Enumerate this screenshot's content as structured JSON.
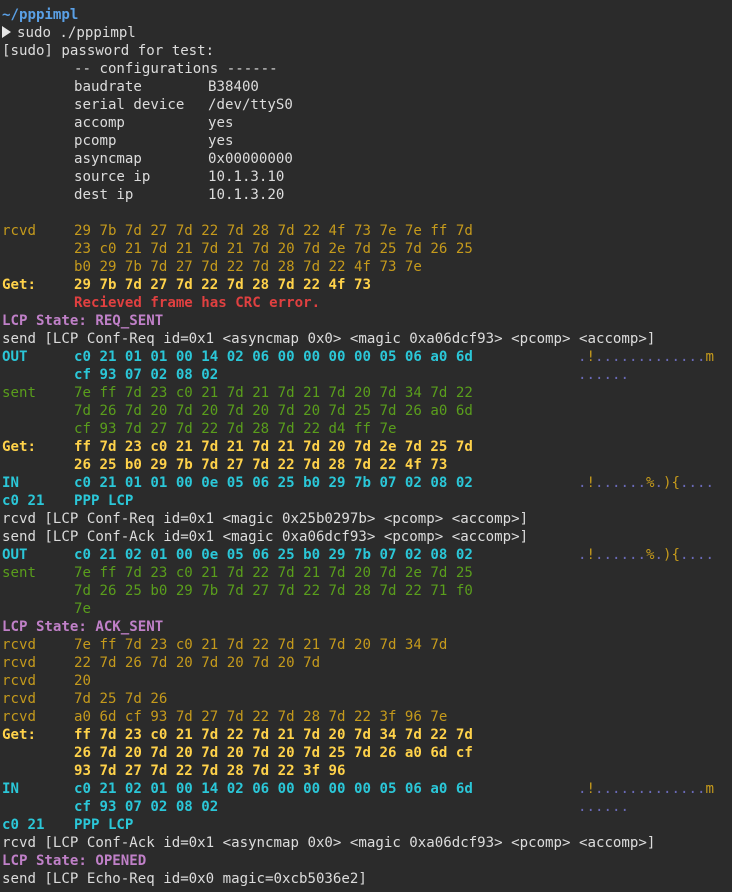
{
  "colors": {
    "background": "#2b2b2b",
    "default_text": "#dcdcdc",
    "path": "#5aa0e6",
    "rcvd": "#c59a1c",
    "get": "#ffd24a",
    "error": "#e04040",
    "lcp_state": "#c080c8",
    "out_in": "#2bc7d8",
    "sent": "#5a9e1c"
  },
  "lines": [
    {
      "style": "path",
      "c0": "~/pppimpl"
    },
    {
      "style": "prompt",
      "c0": "sudo ./pppimpl"
    },
    {
      "style": "white",
      "c0": "[sudo] password for test:"
    },
    {
      "style": "white",
      "c1": "-- configurations ------"
    },
    {
      "style": "config",
      "c1": "baudrate",
      "val": "B38400"
    },
    {
      "style": "config",
      "c1": "serial device",
      "val": "/dev/ttyS0"
    },
    {
      "style": "config",
      "c1": "accomp",
      "val": "yes"
    },
    {
      "style": "config",
      "c1": "pcomp",
      "val": "yes"
    },
    {
      "style": "config",
      "c1": "asyncmap",
      "val": "0x00000000"
    },
    {
      "style": "config",
      "c1": "source ip",
      "val": "10.1.3.10"
    },
    {
      "style": "config",
      "c1": "dest ip",
      "val": "10.1.3.20"
    },
    {
      "style": "blank"
    },
    {
      "style": "rcvd",
      "c0": "rcvd",
      "c1": "29 7b 7d 27 7d 22 7d 28 7d 22 4f 73 7e 7e ff 7d"
    },
    {
      "style": "rcvd",
      "c1": "23 c0 21 7d 21 7d 21 7d 20 7d 2e 7d 25 7d 26 25"
    },
    {
      "style": "rcvd",
      "c1": "b0 29 7b 7d 27 7d 22 7d 28 7d 22 4f 73 7e"
    },
    {
      "style": "get",
      "c0": "Get:",
      "c1": "29 7b 7d 27 7d 22 7d 28 7d 22 4f 73"
    },
    {
      "style": "err",
      "c1": "Recieved frame has CRC error."
    },
    {
      "style": "state",
      "c0": "LCP State: REQ_SENT"
    },
    {
      "style": "white",
      "c0": "send [LCP Conf-Req id=0x1 <asyncmap 0x0> <magic 0xa06dcf93> <pcomp> <accomp>]"
    },
    {
      "style": "out",
      "c0": "OUT",
      "c1": "c0 21 01 01 00 14 02 06 00 00 00 00 05 06 a0 6d",
      "c2": ".!.............m"
    },
    {
      "style": "out",
      "c1": "cf 93 07 02 08 02",
      "c2": "......"
    },
    {
      "style": "sent",
      "c0": "sent",
      "c1": "7e ff 7d 23 c0 21 7d 21 7d 21 7d 20 7d 34 7d 22"
    },
    {
      "style": "sent",
      "c1": "7d 26 7d 20 7d 20 7d 20 7d 20 7d 25 7d 26 a0 6d"
    },
    {
      "style": "sent",
      "c1": "cf 93 7d 27 7d 22 7d 28 7d 22 d4 ff 7e"
    },
    {
      "style": "get",
      "c0": "Get:",
      "c1": "ff 7d 23 c0 21 7d 21 7d 21 7d 20 7d 2e 7d 25 7d"
    },
    {
      "style": "get",
      "c1": "26 25 b0 29 7b 7d 27 7d 22 7d 28 7d 22 4f 73"
    },
    {
      "style": "out",
      "c0": "IN",
      "c1": "c0 21 01 01 00 0e 05 06 25 b0 29 7b 07 02 08 02",
      "c2": ".!......%.){...."
    },
    {
      "style": "out",
      "c0": "c0 21",
      "c1": "PPP LCP"
    },
    {
      "style": "white",
      "c0": "rcvd [LCP Conf-Req id=0x1 <magic 0x25b0297b> <pcomp> <accomp>]"
    },
    {
      "style": "white",
      "c0": "send [LCP Conf-Ack id=0x1 <magic 0xa06dcf93> <pcomp> <accomp>]"
    },
    {
      "style": "out",
      "c0": "OUT",
      "c1": "c0 21 02 01 00 0e 05 06 25 b0 29 7b 07 02 08 02",
      "c2": ".!......%.){...."
    },
    {
      "style": "sent",
      "c0": "sent",
      "c1": "7e ff 7d 23 c0 21 7d 22 7d 21 7d 20 7d 2e 7d 25"
    },
    {
      "style": "sent",
      "c1": "7d 26 25 b0 29 7b 7d 27 7d 22 7d 28 7d 22 71 f0"
    },
    {
      "style": "sent",
      "c1": "7e"
    },
    {
      "style": "state",
      "c0": "LCP State: ACK_SENT"
    },
    {
      "style": "rcvd",
      "c0": "rcvd",
      "c1": "7e ff 7d 23 c0 21 7d 22 7d 21 7d 20 7d 34 7d"
    },
    {
      "style": "rcvd",
      "c0": "rcvd",
      "c1": "22 7d 26 7d 20 7d 20 7d 20 7d"
    },
    {
      "style": "rcvd",
      "c0": "rcvd",
      "c1": "20"
    },
    {
      "style": "rcvd",
      "c0": "rcvd",
      "c1": "7d 25 7d 26"
    },
    {
      "style": "rcvd",
      "c0": "rcvd",
      "c1": "a0 6d cf 93 7d 27 7d 22 7d 28 7d 22 3f 96 7e"
    },
    {
      "style": "get",
      "c0": "Get:",
      "c1": "ff 7d 23 c0 21 7d 22 7d 21 7d 20 7d 34 7d 22 7d"
    },
    {
      "style": "get",
      "c1": "26 7d 20 7d 20 7d 20 7d 20 7d 25 7d 26 a0 6d cf"
    },
    {
      "style": "get",
      "c1": "93 7d 27 7d 22 7d 28 7d 22 3f 96"
    },
    {
      "style": "out",
      "c0": "IN",
      "c1": "c0 21 02 01 00 14 02 06 00 00 00 00 05 06 a0 6d",
      "c2": ".!.............m"
    },
    {
      "style": "out",
      "c1": "cf 93 07 02 08 02",
      "c2": "......"
    },
    {
      "style": "out",
      "c0": "c0 21",
      "c1": "PPP LCP"
    },
    {
      "style": "white",
      "c0": "rcvd [LCP Conf-Ack id=0x1 <asyncmap 0x0> <magic 0xa06dcf93> <pcomp> <accomp>]"
    },
    {
      "style": "state",
      "c0": "LCP State: OPENED"
    },
    {
      "style": "white",
      "c0": "send [LCP Echo-Req id=0x0 magic=0xcb5036e2]"
    }
  ]
}
